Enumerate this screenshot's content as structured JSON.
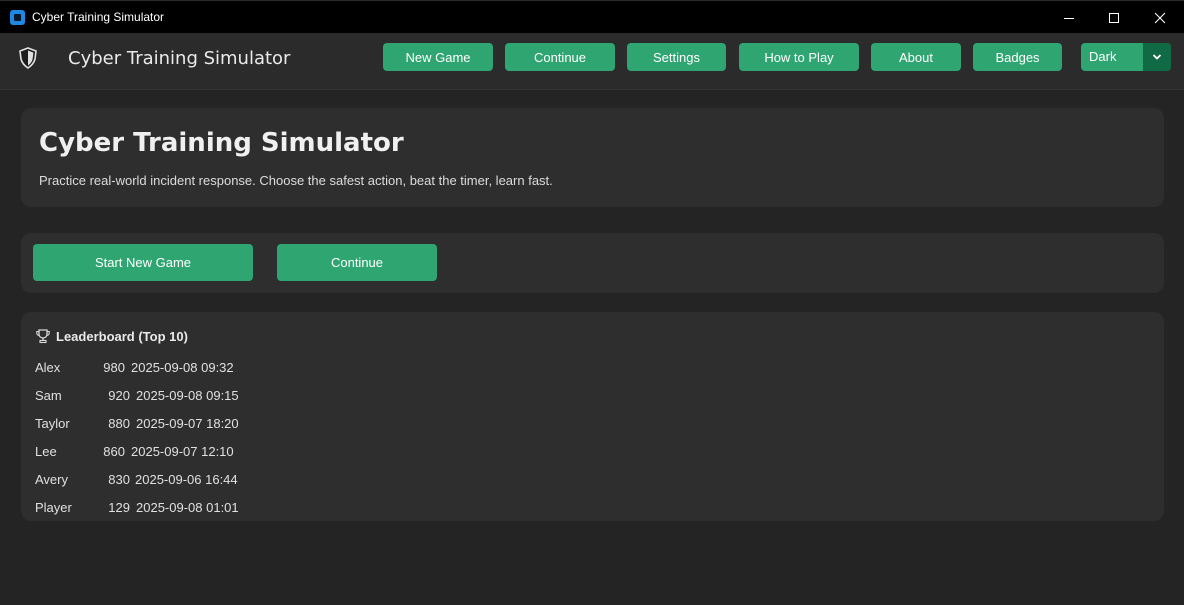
{
  "window": {
    "title": "Cyber Training Simulator",
    "controls": [
      "minimize-icon",
      "maximize-icon",
      "close-icon"
    ]
  },
  "topbar": {
    "logo_icon": "shield-icon",
    "title": "Cyber Training Simulator",
    "nav": {
      "new_game": "New Game",
      "continue": "Continue",
      "settings": "Settings",
      "how_to_play": "How to Play",
      "about": "About",
      "badges": "Badges"
    },
    "theme_select": {
      "value": "Dark",
      "icon": "chevron-down-icon"
    }
  },
  "hero": {
    "title": "Cyber Training Simulator",
    "subtitle": "Practice real-world incident response. Choose the safest action, beat the timer, learn fast."
  },
  "actions": {
    "start_new_game": "Start New Game",
    "continue": "Continue"
  },
  "leaderboard": {
    "icon": "trophy-icon",
    "title": "Leaderboard (Top 10)",
    "rows": [
      {
        "name": "Alex",
        "score": "980",
        "date": "2025-09-08 09:32"
      },
      {
        "name": "Sam",
        "score": "920",
        "date": "2025-09-08 09:15"
      },
      {
        "name": "Taylor",
        "score": "880",
        "date": "2025-09-07 18:20"
      },
      {
        "name": "Lee",
        "score": "860",
        "date": "2025-09-07 12:10"
      },
      {
        "name": "Avery",
        "score": "830",
        "date": "2025-09-06 16:44"
      },
      {
        "name": "Player",
        "score": "129",
        "date": "2025-09-08 01:01"
      }
    ]
  },
  "colors": {
    "accent": "#2fa572",
    "accent_dark": "#106a43",
    "background": "#242424",
    "card": "#2e2e2e",
    "titlebar": "#000000"
  }
}
